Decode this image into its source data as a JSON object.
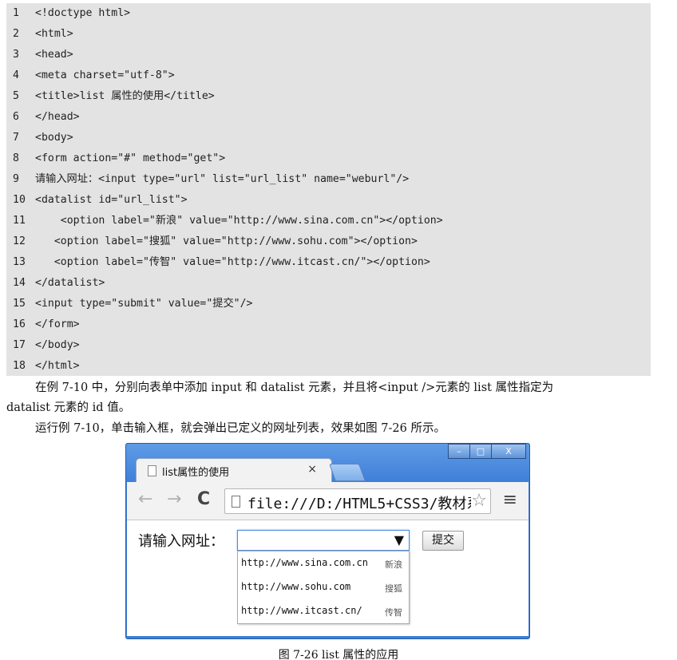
{
  "code": {
    "lines": [
      {
        "n": "1",
        "text": "<!doctype html>"
      },
      {
        "n": "2",
        "text": "<html>"
      },
      {
        "n": "3",
        "text": "<head>"
      },
      {
        "n": "4",
        "text": "<meta charset=\"utf-8\">"
      },
      {
        "n": "5",
        "text": "<title>list 属性的使用</title>"
      },
      {
        "n": "6",
        "text": "</head>"
      },
      {
        "n": "7",
        "text": "<body>"
      },
      {
        "n": "8",
        "text": "<form action=\"#\" method=\"get\">"
      },
      {
        "n": "9",
        "text": "请输入网址：<input type=\"url\" list=\"url_list\" name=\"weburl\"/>"
      },
      {
        "n": "10",
        "text": "<datalist id=\"url_list\">"
      },
      {
        "n": "11",
        "text": "    <option label=\"新浪\" value=\"http://www.sina.com.cn\"></option>"
      },
      {
        "n": "12",
        "text": "   <option label=\"搜狐\" value=\"http://www.sohu.com\"></option>"
      },
      {
        "n": "13",
        "text": "   <option label=\"传智\" value=\"http://www.itcast.cn/\"></option>"
      },
      {
        "n": "14",
        "text": "</datalist>"
      },
      {
        "n": "15",
        "text": "<input type=\"submit\" value=\"提交\"/>"
      },
      {
        "n": "16",
        "text": "</form>"
      },
      {
        "n": "17",
        "text": "</body>"
      },
      {
        "n": "18",
        "text": "</html>"
      }
    ]
  },
  "paragraphs": {
    "p1_line1": "在例 7-10 中，分别向表单中添加 input  和 datalist 元素，并且将<input />元素的 list 属性指定为",
    "p1_line2": "datalist 元素的 id 值。",
    "p2": "运行例 7-10，单击输入框，就会弹出已定义的网址列表，效果如图 7-26 所示。"
  },
  "browser": {
    "tab_title": "list属性的使用",
    "tab_close": "×",
    "window_buttons": [
      "–",
      "□",
      "X"
    ],
    "back_icon": "←",
    "forward_icon": "→",
    "reload_icon": "C",
    "url": "file:///D:/HTML5+CSS3/教材系",
    "star_icon": "☆",
    "menu_icon": "≡",
    "form_label": "请输入网址：",
    "dropdown_arrow": "▼",
    "submit_label": "提交",
    "options": [
      {
        "url": "http://www.sina.com.cn",
        "label": "新浪"
      },
      {
        "url": "http://www.sohu.com",
        "label": "搜狐"
      },
      {
        "url": "http://www.itcast.cn/",
        "label": "传智"
      }
    ]
  },
  "caption": "图 7-26  list 属性的应用",
  "colors": {
    "code_bg": "#e3e3e3",
    "window_frame": "#3d7ed6",
    "input_focus": "#4a8be0"
  }
}
